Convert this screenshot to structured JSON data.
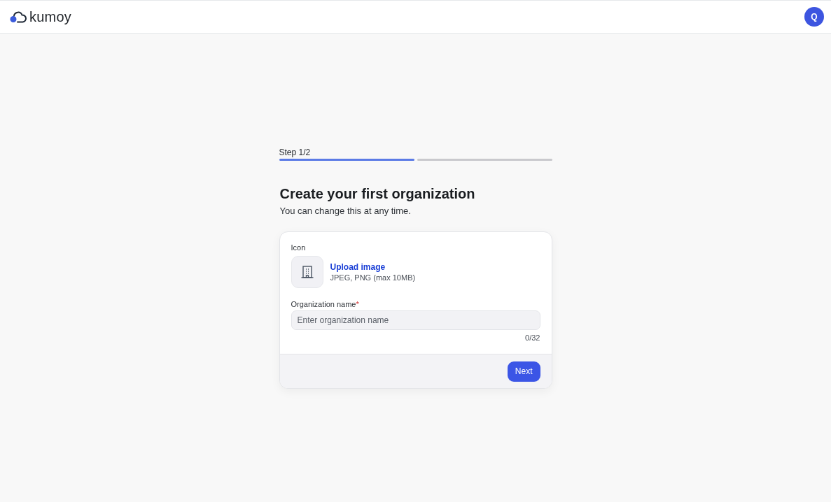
{
  "header": {
    "logo_text": "kumoy",
    "avatar_initial": "Q"
  },
  "progress": {
    "label": "Step 1/2",
    "segments": [
      {
        "filled": true
      },
      {
        "filled": false
      }
    ]
  },
  "heading": "Create your first organization",
  "subtitle": "You can change this at any time.",
  "form": {
    "icon_label": "Icon",
    "upload_link": "Upload image",
    "upload_hint": "JPEG, PNG (max 10MB)",
    "name_label": "Organization name",
    "required_mark": "*",
    "name_placeholder": "Enter organization name",
    "counter": "0/32",
    "next_button": "Next"
  }
}
